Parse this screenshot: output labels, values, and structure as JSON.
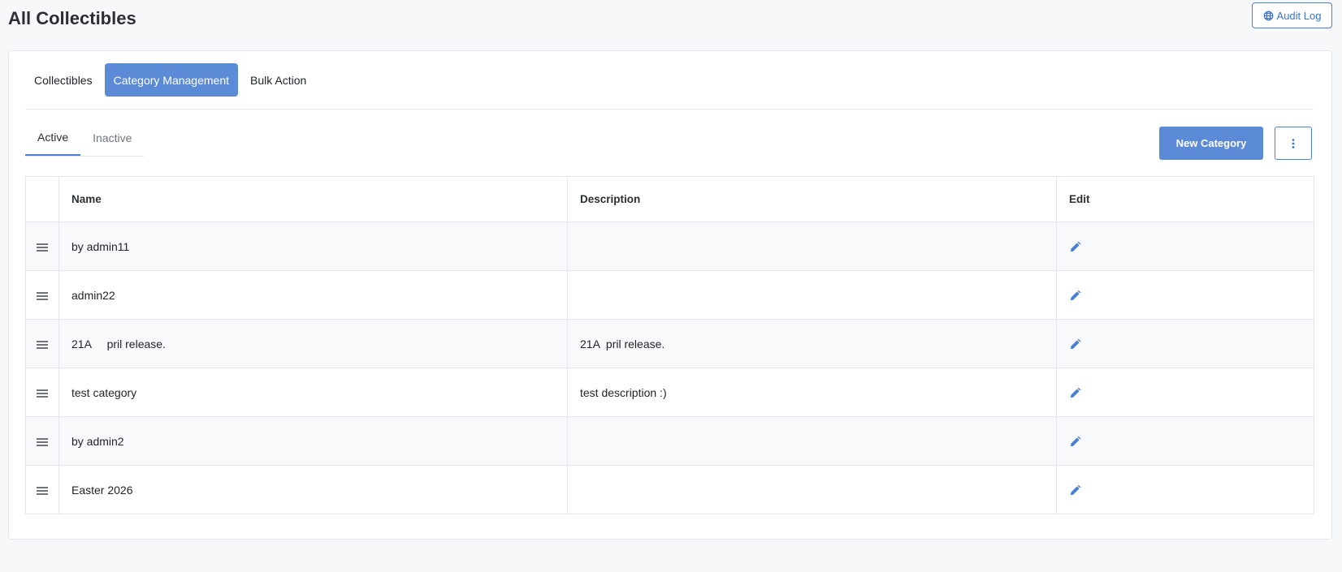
{
  "page": {
    "title": "All Collectibles"
  },
  "audit_log": {
    "label": "Audit Log",
    "icon": "globe-icon"
  },
  "main_tabs": [
    {
      "label": "Collectibles",
      "active": false
    },
    {
      "label": "Category Management",
      "active": true
    },
    {
      "label": "Bulk Action",
      "active": false
    }
  ],
  "sub_tabs": [
    {
      "label": "Active",
      "active": true
    },
    {
      "label": "Inactive",
      "active": false
    }
  ],
  "actions": {
    "new_category": "New Category",
    "more_icon": "kebab-vertical-icon"
  },
  "table": {
    "headers": {
      "name": "Name",
      "description": "Description",
      "edit": "Edit"
    },
    "rows": [
      {
        "name": "by admin11",
        "description": ""
      },
      {
        "name": "admin22",
        "description": ""
      },
      {
        "name": "21A     pril release.",
        "description": "21A  pril release."
      },
      {
        "name": "test category",
        "description": "test description :)"
      },
      {
        "name": "by admin2",
        "description": ""
      },
      {
        "name": "Easter 2026",
        "description": ""
      }
    ]
  },
  "colors": {
    "accent": "#5b8ad6",
    "accent_border": "#4a7fd4",
    "background": "#f7f8fa",
    "row_stripe": "#f8f9fb"
  }
}
